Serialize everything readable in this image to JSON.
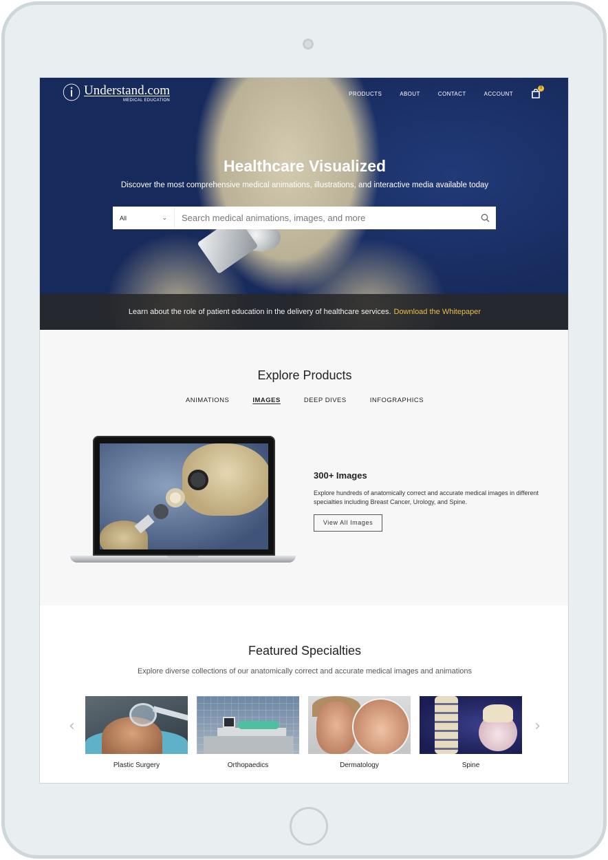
{
  "brand": {
    "name": "Understand.com",
    "tagline": "MEDICAL EDUCATION",
    "mark": "ⓘ"
  },
  "nav": {
    "items": [
      "PRODUCTS",
      "ABOUT",
      "CONTACT",
      "ACCOUNT"
    ],
    "cart_count": "0"
  },
  "hero": {
    "title": "Healthcare Visualized",
    "subtitle": "Discover the most comprehensive medical animations, illustrations, and interactive media available today",
    "search": {
      "category": "All",
      "placeholder": "Search medical animations, images, and more"
    }
  },
  "whitepaper": {
    "text": "Learn about the role of patient education in the delivery of healthcare services.",
    "link": "Download the Whitepaper"
  },
  "explore": {
    "title": "Explore Products",
    "tabs": [
      "ANIMATIONS",
      "IMAGES",
      "DEEP DIVES",
      "INFOGRAPHICS"
    ],
    "active_tab": "IMAGES",
    "product": {
      "title": "300+ Images",
      "description": "Explore hundreds of anatomically correct and accurate medical images in different specialties including Breast Cancer, Urology, and Spine.",
      "button": "View All Images"
    }
  },
  "specialties": {
    "title": "Featured Specialties",
    "subtitle": "Explore diverse collections of our anatomically correct and accurate medical images and animations",
    "items": [
      "Plastic Surgery",
      "Orthopaedics",
      "Dermatology",
      "Spine"
    ]
  },
  "colors": {
    "accent_link": "#e9bf45",
    "hero_bg": "#1d2f68",
    "section_bg": "#f7f7f7"
  }
}
